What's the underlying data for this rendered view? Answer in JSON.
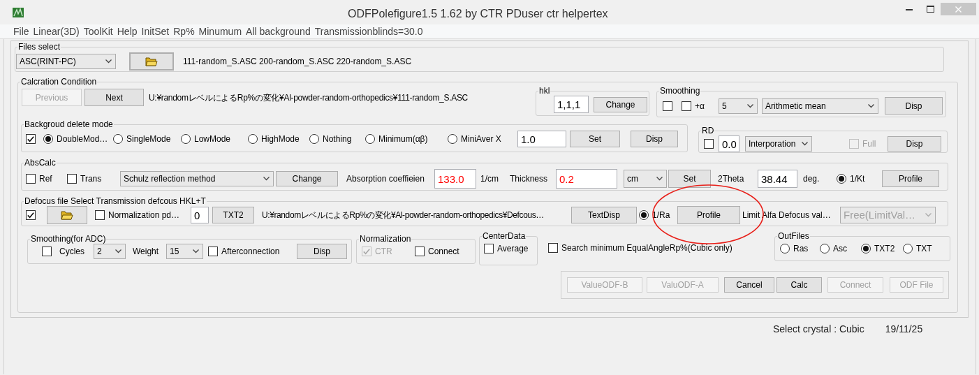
{
  "window": {
    "title": "ODFPolefigure1.5 1.62 by CTR PDuser ctr helpertex"
  },
  "menu": [
    "File",
    "Linear(3D)",
    "ToolKit",
    "Help",
    "InitSet",
    "Rp%",
    "Minumum",
    "All background",
    "Transmissionblinds=30.0"
  ],
  "files_select": {
    "title": "Files select",
    "items": [
      {
        "kind": "combo",
        "value": "ASC(RINT-PC)"
      },
      {
        "kind": "folder_button"
      },
      {
        "kind": "text",
        "text": "111-random_S.ASC 200-random_S.ASC 220-random_S.ASC"
      }
    ]
  },
  "calc_condition": {
    "title": "Calcration Condition",
    "items": [
      {
        "kind": "button",
        "label": "Previous",
        "disabled": true
      },
      {
        "kind": "button",
        "label": "Next",
        "disabled": false
      },
      {
        "kind": "text",
        "text": "U:¥randomレベルによるRp%の変化¥Al-powder-random-orthopedics¥111-random_S.ASC"
      }
    ]
  },
  "hkl": {
    "title": "hkl",
    "items": [
      {
        "kind": "field",
        "value": "1,1,1"
      },
      {
        "kind": "button",
        "label": "Change"
      }
    ]
  },
  "smoothing": {
    "title": "Smoothing",
    "items": [
      {
        "kind": "checkbox",
        "checked": false
      },
      {
        "kind": "checkbox",
        "label": "+α",
        "checked": false
      },
      {
        "kind": "combo",
        "value": "5"
      },
      {
        "kind": "combo",
        "value": "Arithmetic mean"
      },
      {
        "kind": "button",
        "label": "Disp"
      }
    ]
  },
  "background": {
    "title": "Backgroud delete mode",
    "items": [
      {
        "kind": "checkbox",
        "checked": true
      },
      {
        "kind": "radio",
        "label": "DoubleMod…",
        "selected": true
      },
      {
        "kind": "radio",
        "label": "SingleMode",
        "selected": false
      },
      {
        "kind": "radio",
        "label": "LowMode",
        "selected": false
      },
      {
        "kind": "radio",
        "label": "HighMode",
        "selected": false
      },
      {
        "kind": "radio",
        "label": "Nothing",
        "selected": false
      },
      {
        "kind": "radio",
        "label": "Minimum(αβ)",
        "selected": false
      },
      {
        "kind": "radio",
        "label": "MiniAver X",
        "selected": false
      },
      {
        "kind": "field",
        "value": "1.0"
      },
      {
        "kind": "button",
        "label": "Set"
      },
      {
        "kind": "button",
        "label": "Disp"
      }
    ]
  },
  "rd": {
    "title": "RD",
    "items": [
      {
        "kind": "checkbox",
        "checked": false
      },
      {
        "kind": "field",
        "value": "0.0"
      },
      {
        "kind": "combo",
        "value": "Interporation"
      },
      {
        "kind": "checkbox",
        "label": "Full",
        "checked": false,
        "disabled": true
      },
      {
        "kind": "button",
        "label": "Disp"
      }
    ]
  },
  "abs_calc": {
    "title": "AbsCalc",
    "items": [
      {
        "kind": "checkbox",
        "label": "Ref",
        "checked": false
      },
      {
        "kind": "checkbox",
        "label": "Trans",
        "checked": false
      },
      {
        "kind": "combo",
        "value": "Schulz reflection method"
      },
      {
        "kind": "button",
        "label": "Change"
      },
      {
        "kind": "text",
        "text": "Absorption coeffieien"
      },
      {
        "kind": "field",
        "value": "133.0",
        "highlighted": true
      },
      {
        "kind": "text",
        "text": "1/cm"
      },
      {
        "kind": "text",
        "text": "Thickness"
      },
      {
        "kind": "field",
        "value": "0.2",
        "highlighted": true
      },
      {
        "kind": "combo",
        "value": "cm"
      },
      {
        "kind": "button",
        "label": "Set"
      },
      {
        "kind": "text",
        "text": "2Theta"
      },
      {
        "kind": "field",
        "value": "38.44",
        "highlighted": false
      },
      {
        "kind": "text",
        "text": "deg."
      },
      {
        "kind": "radio",
        "label": "1/Kt",
        "selected": true
      },
      {
        "kind": "button",
        "label": "Profile"
      }
    ]
  },
  "defocus": {
    "title": "Defocus file Select Transmission defcous HKL+T",
    "items": [
      {
        "kind": "checkbox",
        "checked": true
      },
      {
        "kind": "folder_button"
      },
      {
        "kind": "checkbox",
        "label": "Normalization  pd…",
        "checked": false
      },
      {
        "kind": "field",
        "value": "0"
      },
      {
        "kind": "button",
        "label": "TXT2"
      },
      {
        "kind": "text",
        "text": "U:¥randomレベルによるRp%の変化¥Al-powder-random-orthopedics¥Defcous…"
      },
      {
        "kind": "button",
        "label": "TextDisp"
      },
      {
        "kind": "radio",
        "label": "1/Ra",
        "selected": true
      },
      {
        "kind": "button",
        "label": "Profile"
      },
      {
        "kind": "text",
        "text": "Limit Alfa Defocus val…"
      },
      {
        "kind": "combo",
        "value": "Free(LimitVal…",
        "disabled": true
      }
    ]
  },
  "smoothing_adc": {
    "title": "Smoothing(for ADC)",
    "items": [
      {
        "kind": "checkbox",
        "checked": false
      },
      {
        "kind": "text",
        "text": "Cycles"
      },
      {
        "kind": "combo",
        "value": "2"
      },
      {
        "kind": "text",
        "text": "Weight"
      },
      {
        "kind": "combo",
        "value": "15"
      },
      {
        "kind": "checkbox",
        "label": "Afterconnection",
        "checked": false
      },
      {
        "kind": "button",
        "label": "Disp"
      }
    ]
  },
  "normalization": {
    "title": "Normalization",
    "items": [
      {
        "kind": "checkbox",
        "label": "CTR",
        "checked": true,
        "disabled": true
      },
      {
        "kind": "checkbox",
        "label": "Connect",
        "checked": false,
        "disabled": false
      }
    ]
  },
  "center_data": {
    "title": "CenterData",
    "items": [
      {
        "kind": "checkbox",
        "label": "Average",
        "checked": false
      }
    ]
  },
  "search_minimum": {
    "items": [
      {
        "kind": "checkbox",
        "label": "Search minimum EqualAngleRp%(Cubic only)",
        "checked": false
      }
    ]
  },
  "out_files": {
    "title": "OutFiles",
    "items": [
      {
        "kind": "radio",
        "label": "Ras",
        "selected": false
      },
      {
        "kind": "radio",
        "label": "Asc",
        "selected": false
      },
      {
        "kind": "radio",
        "label": "TXT2",
        "selected": true
      },
      {
        "kind": "radio",
        "label": "TXT",
        "selected": false
      }
    ]
  },
  "actions": {
    "items": [
      {
        "kind": "button",
        "label": "ValueODF-B",
        "disabled": true
      },
      {
        "kind": "button",
        "label": "ValuODF-A",
        "disabled": true
      },
      {
        "kind": "button",
        "label": "Cancel",
        "disabled": false
      },
      {
        "kind": "button",
        "label": "Calc",
        "disabled": false
      },
      {
        "kind": "button",
        "label": "Connect",
        "disabled": true
      },
      {
        "kind": "button",
        "label": "ODF File",
        "disabled": true
      }
    ]
  },
  "status_bar": {
    "crystal": "Select crystal : Cubic",
    "date": "19/11/25"
  }
}
